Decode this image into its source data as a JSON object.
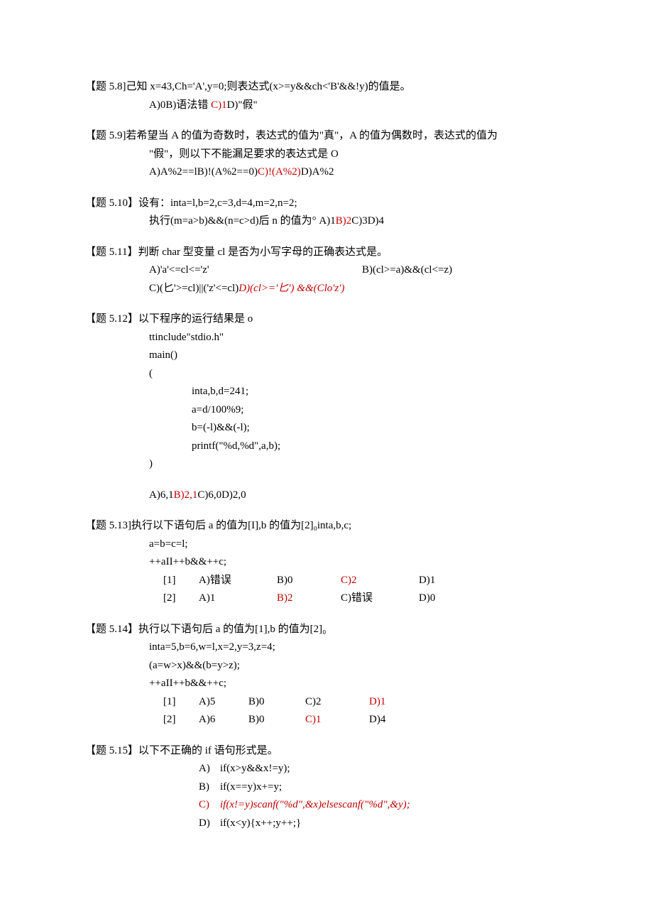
{
  "q58": {
    "title": "【题 5.8]己知 x=43,Ch='A',y=0;则表达式(x>=y&&ch<'B'&&!y)的值是。",
    "opts_pre": "A)0B)语法错 ",
    "opts_red": "C)1",
    "opts_post": "D)\"假\""
  },
  "q59": {
    "title": "【题 5.9]若希望当 A 的值为奇数时，表达式的值为\"真\"，A 的值为偶数时，表达式的值为",
    "cont": "\"假\"，则以下不能漏足要求的表达式是 O",
    "opts_pre": "A)A%2==lB)!(A%2==0)",
    "opts_red": "C)!(A%2)",
    "opts_post": "D)A%2"
  },
  "q510": {
    "title": "【题 5.10】设有：inta=l,b=2,c=3,d=4,m=2,n=2;",
    "cont_pre": "执行(m=a>b)&&(n=c>d)后 n 的值为° A)1",
    "cont_red": "B)2",
    "cont_post": "C)3D)4"
  },
  "q511": {
    "title": "【题 5.11】判断 char 型变量 cl 是否为小写字母的正确表达式是。",
    "a": "A)'a'<=cl<='z'",
    "b": "B)(cl>=a)&&(cl<=z)",
    "c_pre": "C)(匕'>=cl)||('z'<=cl)",
    "c_red": "D)(cl>='匕') &&(Clo'z')"
  },
  "q512": {
    "title": "【题 5.12】以下程序的运行结果是 o",
    "code": [
      "ttinclude\"stdio.h\"",
      "main()",
      "("
    ],
    "code2": [
      "inta,b,d=241;",
      "a=d/100%9;",
      "b=(-l)&&(-l);",
      "printf(\"%d,%d\",a,b);"
    ],
    "code_end": ")",
    "opts_pre": "A)6,1",
    "opts_red": "B)2,1",
    "opts_post": "C)6,0D)2,0"
  },
  "q513": {
    "title": "【题 5.13]执行以下语句后 a 的值为[I],b 的值为[2]₀inta,b,c;",
    "l1": "a=b=c=l;",
    "l2": "++aII++b&&++c;",
    "r1": {
      "idx": "[1]",
      "a": "A)错误",
      "b": "B)0",
      "c": "C)2",
      "d": "D)1"
    },
    "r2": {
      "idx": "[2]",
      "a": "A)1",
      "b": "B)2",
      "c": "C)错误",
      "d": "D)0"
    }
  },
  "q514": {
    "title": "【题 5.14】执行以下语句后 a 的值为[1],b 的值为[2]₀",
    "l1": "inta=5,b=6,w=l,x=2,y=3,z=4;",
    "l2": "(a=w>x)&&(b=y>z);",
    "l3": "++aII++b&&++c;",
    "r1": {
      "idx": "[1]",
      "a": "A)5",
      "b": "B)0",
      "c": "C)2",
      "d": "D)1"
    },
    "r2": {
      "idx": "[2]",
      "a": "A)6",
      "b": "B)0",
      "c": "C)1",
      "d": "D)4"
    }
  },
  "q515": {
    "title": "【题 5.15】以下不正确的 if 语句形式是。",
    "a": "if(x>y&&x!=y);",
    "b": "if(x==y)x+=y;",
    "c": "if(x!=y)scanf(\"%d\",&x)elsescanf(\"%d\",&y);",
    "d": "if(x<y){x++;y++;}"
  }
}
